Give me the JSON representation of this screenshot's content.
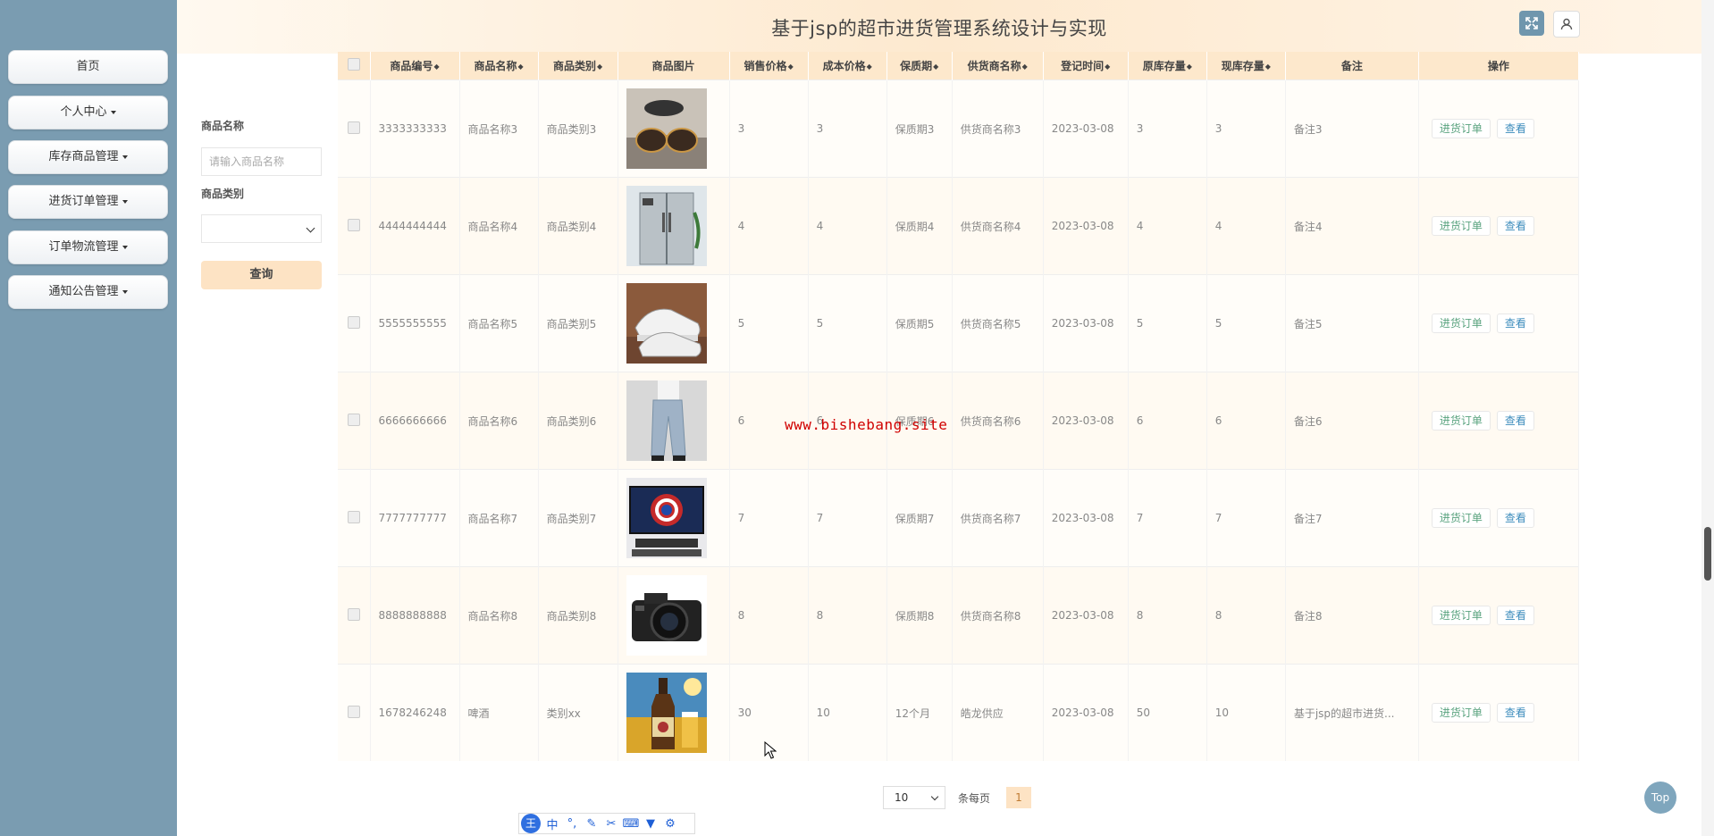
{
  "header": {
    "title": "基于jsp的超市进货管理系统设计与实现"
  },
  "sidebar": {
    "items": [
      {
        "label": "首页",
        "dropdown": false
      },
      {
        "label": "个人中心",
        "dropdown": true
      },
      {
        "label": "库存商品管理",
        "dropdown": true
      },
      {
        "label": "进货订单管理",
        "dropdown": true
      },
      {
        "label": "订单物流管理",
        "dropdown": true
      },
      {
        "label": "通知公告管理",
        "dropdown": true
      }
    ]
  },
  "search": {
    "name_label": "商品名称",
    "name_placeholder": "请输入商品名称",
    "category_label": "商品类别",
    "category_value": "",
    "query_label": "查询"
  },
  "table": {
    "columns": [
      "商品编号",
      "商品名称",
      "商品类别",
      "商品图片",
      "销售价格",
      "成本价格",
      "保质期",
      "供货商名称",
      "登记时间",
      "原库存量",
      "现库存量",
      "备注",
      "操作"
    ],
    "sortable": [
      true,
      true,
      true,
      false,
      true,
      true,
      true,
      true,
      true,
      true,
      true,
      false,
      false
    ],
    "rows": [
      {
        "id": "3333333333",
        "name": "商品名称3",
        "category": "商品类别3",
        "image": "sunglasses-photo",
        "price": "3",
        "cost": "3",
        "shelf_life": "保质期3",
        "supplier": "供货商名称3",
        "date": "2023-03-08",
        "orig_stock": "3",
        "cur_stock": "3",
        "note": "备注3"
      },
      {
        "id": "4444444444",
        "name": "商品名称4",
        "category": "商品类别4",
        "image": "refrigerator-photo",
        "price": "4",
        "cost": "4",
        "shelf_life": "保质期4",
        "supplier": "供货商名称4",
        "date": "2023-03-08",
        "orig_stock": "4",
        "cur_stock": "4",
        "note": "备注4"
      },
      {
        "id": "5555555555",
        "name": "商品名称5",
        "category": "商品类别5",
        "image": "sneaker-photo",
        "price": "5",
        "cost": "5",
        "shelf_life": "保质期5",
        "supplier": "供货商名称5",
        "date": "2023-03-08",
        "orig_stock": "5",
        "cur_stock": "5",
        "note": "备注5"
      },
      {
        "id": "6666666666",
        "name": "商品名称6",
        "category": "商品类别6",
        "image": "jeans-photo",
        "price": "6",
        "cost": "6",
        "shelf_life": "保质期6",
        "supplier": "供货商名称6",
        "date": "2023-03-08",
        "orig_stock": "6",
        "cur_stock": "6",
        "note": "备注6"
      },
      {
        "id": "7777777777",
        "name": "商品名称7",
        "category": "商品类别7",
        "image": "monitor-photo",
        "price": "7",
        "cost": "7",
        "shelf_life": "保质期7",
        "supplier": "供货商名称7",
        "date": "2023-03-08",
        "orig_stock": "7",
        "cur_stock": "7",
        "note": "备注7"
      },
      {
        "id": "8888888888",
        "name": "商品名称8",
        "category": "商品类别8",
        "image": "camera-photo",
        "price": "8",
        "cost": "8",
        "shelf_life": "保质期8",
        "supplier": "供货商名称8",
        "date": "2023-03-08",
        "orig_stock": "8",
        "cur_stock": "8",
        "note": "备注8"
      },
      {
        "id": "1678246248",
        "name": "啤酒",
        "category": "类别xx",
        "image": "beer-photo",
        "price": "30",
        "cost": "10",
        "shelf_life": "12个月",
        "supplier": "皓龙供应",
        "date": "2023-03-08",
        "orig_stock": "50",
        "cur_stock": "10",
        "note": "基于jsp的超市进货..."
      }
    ],
    "actions": {
      "order": "进货订单",
      "view": "查看"
    }
  },
  "pagination": {
    "page_size": "10",
    "per_page_label": "条每页",
    "current_page": "1"
  },
  "watermark": "www.bishebang.site",
  "top_button": "Top",
  "ime_toolbar": {
    "logo": "王",
    "mode": "中",
    "punct": "°,"
  },
  "colors": {
    "sidebar_bg": "#7a9cb1",
    "header_accent": "#fde8cc",
    "order_btn": "#5aa37f",
    "view_btn": "#3e8dbd",
    "watermark": "#d00000"
  }
}
